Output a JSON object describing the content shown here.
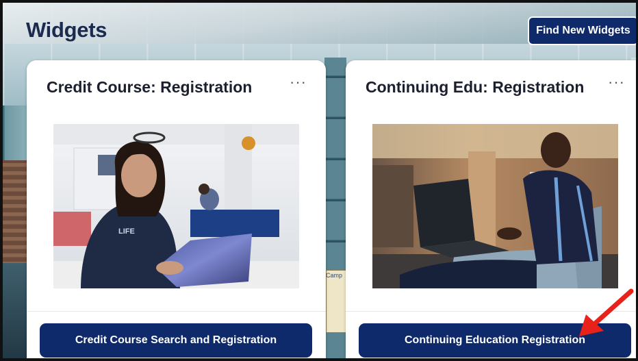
{
  "page": {
    "title": "Widgets",
    "find_button": "Find New Widgets"
  },
  "cards": [
    {
      "title": "Credit Course: Registration",
      "more": "···",
      "button": "Credit Course Search and Registration"
    },
    {
      "title": "Continuing Edu: Registration",
      "more": "···",
      "button": "Continuing Education Registration"
    }
  ],
  "background_sign": "Camp",
  "colors": {
    "primary_button": "#0e2a6b",
    "title_text": "#1b2a4e",
    "annotation_arrow": "#e8221a"
  },
  "icons": {
    "more": "more-options-icon",
    "arrow": "annotation-arrow"
  }
}
